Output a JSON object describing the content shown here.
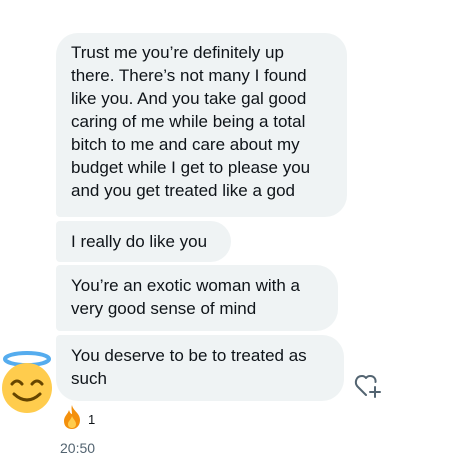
{
  "messages": [
    "Trust me you’re definitely up\nthere. There’s not many I found\nlike you. And you take gal good\ncaring of me while being a total\nbitch to me and care about my\nbudget while I get to please you\nand you get treated like a god",
    "I really do like you",
    "You’re an exotic woman with a\nvery good sense of mind",
    "You deserve to be to treated as\nsuch"
  ],
  "reaction": {
    "icon": "fire-emoji-icon",
    "count": "1"
  },
  "timestamp": "20:50",
  "avatar_icon": "smiling-face-with-halo-emoji",
  "react_button_icon": "heart-plus-icon",
  "colors": {
    "bubble_bg": "#eff3f4",
    "text": "#0f1419",
    "muted": "#536471"
  }
}
